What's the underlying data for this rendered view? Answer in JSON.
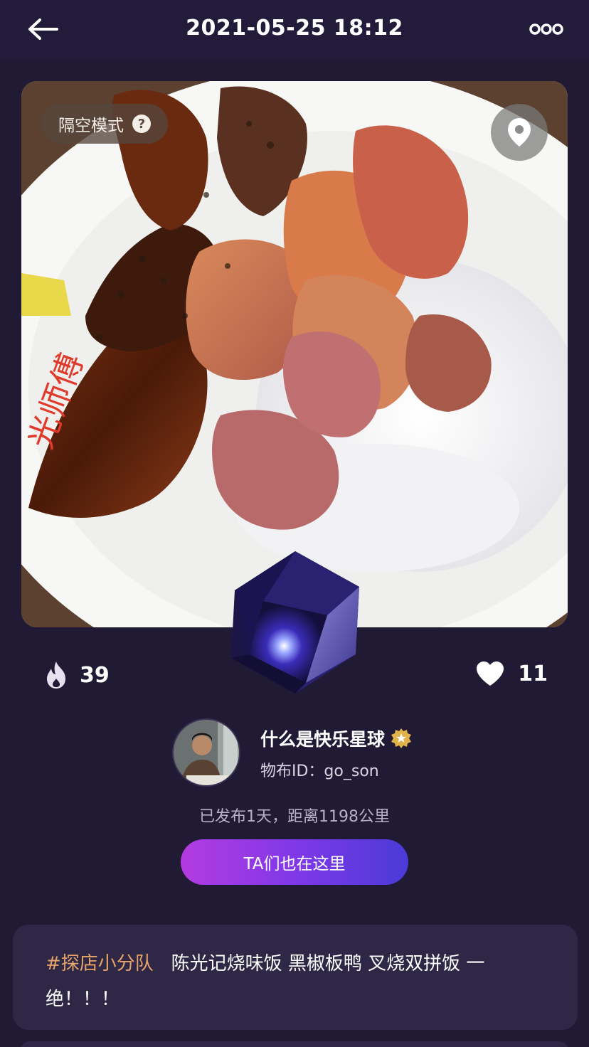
{
  "header": {
    "title": "2021-05-25 18:12",
    "back_icon": "arrow-left-icon",
    "more_icon": "more-dots-icon"
  },
  "photo": {
    "mode_label": "隔空模式",
    "help_glyph": "?",
    "location_icon": "map-pin-icon",
    "plate_text": "光师傅"
  },
  "stats": {
    "fire_count": "39",
    "like_count": "11",
    "fire_icon": "flame-icon",
    "like_icon": "heart-icon"
  },
  "user": {
    "name": "什么是快乐星球",
    "id_text": "物布ID：go_son",
    "badge_icon": "verified-badge-icon"
  },
  "meta_text": "已发布1天，距离1198公里",
  "cta_label": "TA们也在这里",
  "post": {
    "hashtag": "#探店小分队",
    "body": "陈光记烧味饭 黑椒板鸭 叉烧双拼饭 一绝！！！"
  },
  "colors": {
    "background": "#211a35",
    "card": "#2e2746",
    "hashtag": "#e6a36a",
    "cta_start": "#b43be0",
    "cta_end": "#4a3bd6"
  }
}
